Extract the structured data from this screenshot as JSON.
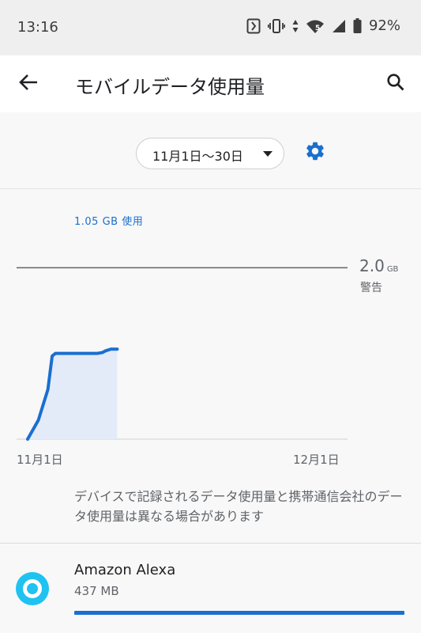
{
  "status_bar": {
    "time": "13:16",
    "battery_percent": "92%",
    "network_badge": "5"
  },
  "app_bar": {
    "title": "モバイルデータ使用量",
    "back_icon": "arrow-back-icon",
    "search_icon": "search-icon"
  },
  "period": {
    "label": "11月1日〜30日",
    "settings_icon": "gear-icon"
  },
  "colors": {
    "accent": "#1a6fd0",
    "chart_fill": "#e3ebf8",
    "alexa": "#1fc2f0"
  },
  "usage": {
    "total": "1.05 GB 使用"
  },
  "warning": {
    "value": "2.0",
    "unit": "GB",
    "label": "警告"
  },
  "chart_data": {
    "type": "area",
    "title": "",
    "xlabel": "",
    "ylabel": "",
    "x_start_label": "11月1日",
    "x_end_label": "12月1日",
    "ylim": [
      0,
      2.4
    ],
    "warning_line": 2.0,
    "days_in_period": 30,
    "x": [
      0,
      1.0,
      1.9,
      2.3,
      2.6,
      3.2,
      5.0,
      6.5,
      7.0,
      7.3,
      7.8,
      8.4
    ],
    "y": [
      0,
      0.22,
      0.58,
      0.97,
      1.0,
      1.0,
      1.0,
      1.0,
      1.01,
      1.03,
      1.05,
      1.05
    ]
  },
  "disclaimer": "デバイスで記録されるデータ使用量と携帯通信会社のデータ使用量は異なる場合があります",
  "apps": [
    {
      "name": "Amazon Alexa",
      "usage": "437 MB",
      "share": 1.0,
      "icon": "alexa-icon"
    }
  ]
}
